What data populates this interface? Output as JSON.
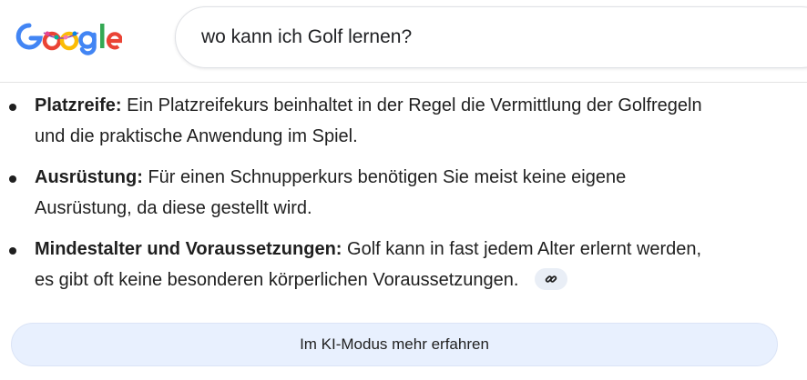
{
  "header": {
    "logo_text": "Google",
    "search_query": "wo kann ich Golf lernen?"
  },
  "bullets": [
    {
      "term": "Platzreife:",
      "line1_rest": "Ein Platzreifekurs beinhaltet in der Regel die Vermittlung der Golfregeln",
      "line2": "und die praktische Anwendung im Spiel."
    },
    {
      "term": "Ausrüstung:",
      "line1_rest": "Für einen Schnupperkurs benötigen Sie meist keine eigene",
      "line2": "Ausrüstung, da diese gestellt wird."
    },
    {
      "term": "Mindestalter und Voraussetzungen:",
      "line1_rest": "Golf kann in fast jedem Alter erlernt werden,",
      "line2": "es gibt oft keine besonderen körperlichen Voraussetzungen."
    }
  ],
  "icons": {
    "source_link": "link-icon"
  },
  "ai_mode_button": {
    "label": "Im KI-Modus mehr erfahren"
  },
  "colors": {
    "button_bg": "#e8f0fe",
    "chip_bg": "#e9eef6",
    "text": "#1f1f1f"
  }
}
